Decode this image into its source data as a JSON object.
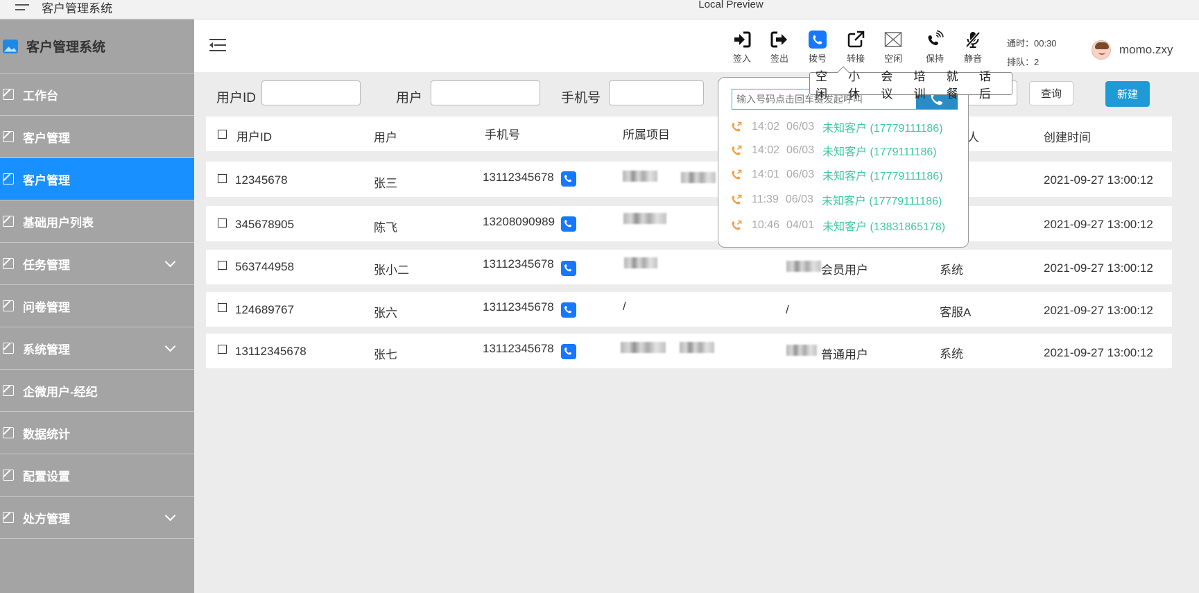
{
  "window": {
    "app_title": "客户管理系统",
    "window_title": "Local Preview"
  },
  "sidebar": {
    "brand": "客户管理系统",
    "items": [
      {
        "label": "工作台"
      },
      {
        "label": "客户管理"
      },
      {
        "label": "客户管理"
      },
      {
        "label": "基础用户列表"
      },
      {
        "label": "任务管理"
      },
      {
        "label": "问卷管理"
      },
      {
        "label": "系统管理"
      },
      {
        "label": "企微用户-经纪"
      },
      {
        "label": "数据统计"
      },
      {
        "label": "配置设置"
      },
      {
        "label": "处方管理"
      }
    ],
    "active_index": 2
  },
  "toolbar": {
    "items": [
      {
        "label": "签入",
        "icon": "sign-in-icon"
      },
      {
        "label": "签出",
        "icon": "sign-out-icon"
      },
      {
        "label": "拨号",
        "icon": "phone-icon"
      },
      {
        "label": "转接",
        "icon": "external-link-icon"
      },
      {
        "label": "空闲",
        "icon": "idle-icon"
      },
      {
        "label": "保持",
        "icon": "hold-icon"
      },
      {
        "label": "静音",
        "icon": "mute-icon"
      }
    ],
    "call_time": "通时：00:30",
    "queue": "排队：2",
    "username": "momo.zxy"
  },
  "status_menu": {
    "options": [
      "空闲",
      "小休",
      "会议",
      "培训",
      "就餐",
      "话后"
    ]
  },
  "dialer": {
    "placeholder": "输入号码点击回车键发起呼叫",
    "records": [
      {
        "time": "14:02",
        "date": "06/03",
        "name": "未知客户 (17779111186)"
      },
      {
        "time": "14:02",
        "date": "06/03",
        "name": "未知客户 (1779111186)"
      },
      {
        "time": "14:01",
        "date": "06/03",
        "name": "未知客户 (17779111186)"
      },
      {
        "time": "11:39",
        "date": "06/03",
        "name": "未知客户 (17779111186)"
      },
      {
        "time": "10:46",
        "date": "04/01",
        "name": "未知客户 (13831865178)"
      }
    ]
  },
  "search": {
    "user_id_label": "用户ID",
    "user_label": "用户",
    "phone_label": "手机号",
    "query_button": "查询",
    "new_button": "新建"
  },
  "table": {
    "headers": {
      "user_id": "用户ID",
      "user": "用户",
      "phone": "手机号",
      "project": "所属项目",
      "owner": "人",
      "created": "创建时间"
    },
    "rows": [
      {
        "user_id": "12345678",
        "user": "张三",
        "phone": "13112345678",
        "project": "",
        "type": "",
        "owner": "",
        "created": "2021-09-27 13:00:12"
      },
      {
        "user_id": "345678905",
        "user": "陈飞",
        "phone": "13208090989",
        "project": "",
        "type": "",
        "owner": "",
        "created": "2021-09-27 13:00:12"
      },
      {
        "user_id": "563744958",
        "user": "张小二",
        "phone": "13112345678",
        "project": "",
        "type": "会员用户",
        "owner": "系统",
        "created": "2021-09-27 13:00:12"
      },
      {
        "user_id": "124689767",
        "user": "张六",
        "phone": "13112345678",
        "project": "/",
        "type": "/",
        "owner": "客服A",
        "created": "2021-09-27 13:00:12"
      },
      {
        "user_id": "13112345678",
        "user": "张七",
        "phone": "13112345678",
        "project": "",
        "type": "普通用户",
        "owner": "系统",
        "created": "2021-09-27 13:00:12"
      }
    ]
  },
  "colors": {
    "sidebar_bg": "#a4a4a4",
    "active": "#1890ff",
    "accent": "#1f9ad6",
    "record_name": "#3cc9a0",
    "record_icon": "#f0a04b"
  }
}
